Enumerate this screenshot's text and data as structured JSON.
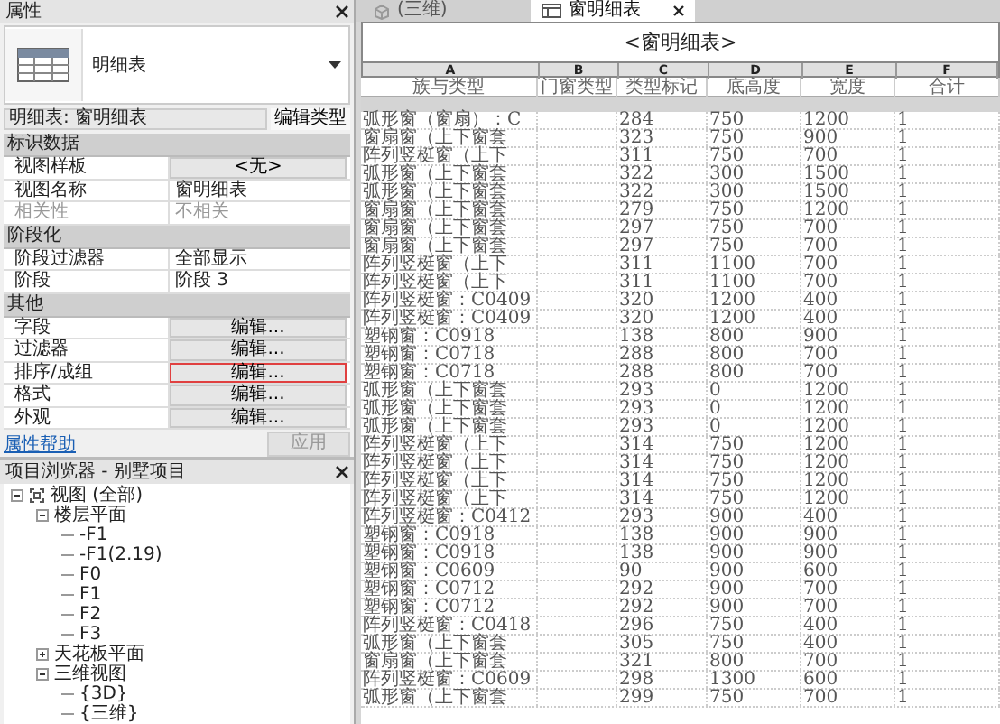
{
  "properties": {
    "title": "属性",
    "type_name": "明细表",
    "instance_selector": "明细表: 窗明细表",
    "edit_type_button": "编辑类型",
    "groups": [
      {
        "name": "标识数据",
        "rows": [
          {
            "label": "视图样板",
            "value": "<无>",
            "kind": "button",
            "disabled": false,
            "highlighted": false
          },
          {
            "label": "视图名称",
            "value": "窗明细表",
            "kind": "text",
            "disabled": false
          },
          {
            "label": "相关性",
            "value": "不相关",
            "kind": "text",
            "disabled": true
          }
        ]
      },
      {
        "name": "阶段化",
        "rows": [
          {
            "label": "阶段过滤器",
            "value": "全部显示",
            "kind": "text",
            "disabled": false
          },
          {
            "label": "阶段",
            "value": "阶段 3",
            "kind": "text",
            "disabled": false
          }
        ]
      },
      {
        "name": "其他",
        "rows": [
          {
            "label": "字段",
            "value": "编辑...",
            "kind": "button",
            "disabled": false,
            "highlighted": false
          },
          {
            "label": "过滤器",
            "value": "编辑...",
            "kind": "button",
            "disabled": false,
            "highlighted": false
          },
          {
            "label": "排序/成组",
            "value": "编辑...",
            "kind": "button",
            "disabled": false,
            "highlighted": true
          },
          {
            "label": "格式",
            "value": "编辑...",
            "kind": "button",
            "disabled": false,
            "highlighted": false
          },
          {
            "label": "外观",
            "value": "编辑...",
            "kind": "button",
            "disabled": false,
            "highlighted": false
          }
        ]
      }
    ],
    "help_link": "属性帮助",
    "apply_button": {
      "label": "应用",
      "disabled": true
    }
  },
  "project_browser": {
    "title": "项目浏览器 - 别墅项目",
    "tree": [
      {
        "label": "视图 (全部)",
        "expanded": true,
        "children": [
          {
            "label": "楼层平面",
            "expanded": true,
            "children": [
              {
                "label": "-F1"
              },
              {
                "label": "-F1(2.19)"
              },
              {
                "label": "F0"
              },
              {
                "label": "F1"
              },
              {
                "label": "F2"
              },
              {
                "label": "F3"
              }
            ]
          },
          {
            "label": "天花板平面",
            "expanded": false
          },
          {
            "label": "三维视图",
            "expanded": true,
            "children": [
              {
                "label": "{3D}"
              },
              {
                "label": "{三维}"
              }
            ]
          }
        ]
      }
    ]
  },
  "tabs": [
    {
      "label": "(三维)",
      "kind": "model",
      "selected": false
    },
    {
      "label": "窗明细表",
      "kind": "schedule",
      "selected": true
    }
  ],
  "schedule": {
    "title": "<窗明细表>",
    "columns": [
      {
        "letter": "A",
        "name": "族与类型"
      },
      {
        "letter": "B",
        "name": "门窗类型"
      },
      {
        "letter": "C",
        "name": "类型标记"
      },
      {
        "letter": "D",
        "name": "底高度"
      },
      {
        "letter": "E",
        "name": "宽度"
      },
      {
        "letter": "F",
        "name": "合计"
      }
    ],
    "rows": [
      [
        "弧形窗（窗扇）：C",
        null,
        "284",
        "750",
        "1200",
        "1"
      ],
      [
        "窗扇窗（上下窗套",
        null,
        "323",
        "750",
        "900",
        "1"
      ],
      [
        "阵列竖梃窗（上下",
        null,
        "311",
        "750",
        "700",
        "1"
      ],
      [
        "弧形窗（上下窗套",
        null,
        "322",
        "300",
        "1500",
        "1"
      ],
      [
        "弧形窗（上下窗套",
        null,
        "322",
        "300",
        "1500",
        "1"
      ],
      [
        "窗扇窗（上下窗套",
        null,
        "279",
        "750",
        "1200",
        "1"
      ],
      [
        "窗扇窗（上下窗套",
        null,
        "297",
        "750",
        "700",
        "1"
      ],
      [
        "窗扇窗（上下窗套",
        null,
        "297",
        "750",
        "700",
        "1"
      ],
      [
        "阵列竖梃窗（上下",
        null,
        "311",
        "1100",
        "700",
        "1"
      ],
      [
        "阵列竖梃窗（上下",
        null,
        "311",
        "1100",
        "700",
        "1"
      ],
      [
        "阵列竖梃窗：C0409",
        null,
        "320",
        "1200",
        "400",
        "1"
      ],
      [
        "阵列竖梃窗：C0409",
        null,
        "320",
        "1200",
        "400",
        "1"
      ],
      [
        "塑钢窗：C0918",
        null,
        "138",
        "800",
        "900",
        "1"
      ],
      [
        "塑钢窗：C0718",
        null,
        "288",
        "800",
        "700",
        "1"
      ],
      [
        "塑钢窗：C0718",
        null,
        "288",
        "800",
        "700",
        "1"
      ],
      [
        "弧形窗（上下窗套",
        null,
        "293",
        "0",
        "1200",
        "1"
      ],
      [
        "弧形窗（上下窗套",
        null,
        "293",
        "0",
        "1200",
        "1"
      ],
      [
        "弧形窗（上下窗套",
        null,
        "293",
        "0",
        "1200",
        "1"
      ],
      [
        "阵列竖梃窗（上下",
        null,
        "314",
        "750",
        "1200",
        "1"
      ],
      [
        "阵列竖梃窗（上下",
        null,
        "314",
        "750",
        "1200",
        "1"
      ],
      [
        "阵列竖梃窗（上下",
        null,
        "314",
        "750",
        "1200",
        "1"
      ],
      [
        "阵列竖梃窗（上下",
        null,
        "314",
        "750",
        "1200",
        "1"
      ],
      [
        "阵列竖梃窗：C0412",
        null,
        "293",
        "900",
        "400",
        "1"
      ],
      [
        "塑钢窗：C0918",
        null,
        "138",
        "900",
        "900",
        "1"
      ],
      [
        "塑钢窗：C0918",
        null,
        "138",
        "900",
        "900",
        "1"
      ],
      [
        "塑钢窗：C0609",
        null,
        "90",
        "900",
        "600",
        "1"
      ],
      [
        "塑钢窗：C0712",
        null,
        "292",
        "900",
        "700",
        "1"
      ],
      [
        "塑钢窗：C0712",
        null,
        "292",
        "900",
        "700",
        "1"
      ],
      [
        "阵列竖梃窗：C0418",
        null,
        "296",
        "750",
        "400",
        "1"
      ],
      [
        "弧形窗（上下窗套",
        null,
        "305",
        "750",
        "400",
        "1"
      ],
      [
        "窗扇窗（上下窗套",
        null,
        "321",
        "800",
        "700",
        "1"
      ],
      [
        "阵列竖梃窗：C0609",
        null,
        "298",
        "1300",
        "600",
        "1"
      ],
      [
        "弧形窗（上下窗套",
        null,
        "299",
        "750",
        "700",
        "1"
      ]
    ]
  }
}
